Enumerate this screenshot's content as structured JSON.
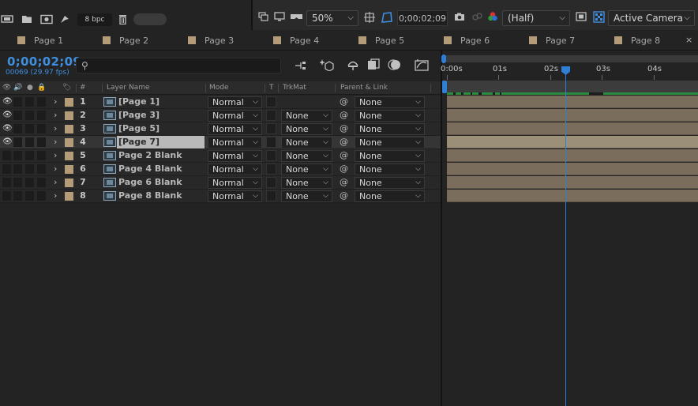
{
  "toolbar": {
    "bpc_label": "8 bpc",
    "zoom": "50%",
    "time": "0;00;02;09",
    "resolution": "(Half)",
    "camera": "Active Camera"
  },
  "tabs": [
    {
      "label": "Page 1"
    },
    {
      "label": "Page 2"
    },
    {
      "label": "Page 3"
    },
    {
      "label": "Page 4"
    },
    {
      "label": "Page 5"
    },
    {
      "label": "Page 6"
    },
    {
      "label": "Page 7"
    },
    {
      "label": "Page 8"
    }
  ],
  "tab_close": "×",
  "timecode": "0;00;02;09",
  "fps": "00069 (29.97 fps)",
  "search": {
    "placeholder": ""
  },
  "headers": {
    "num": "#",
    "layer_name": "Layer Name",
    "mode": "Mode",
    "t": "T",
    "trkmat": "TrkMat",
    "parent": "Parent & Link"
  },
  "layers": [
    {
      "num": "1",
      "name": "[Page 1]",
      "mode": "Normal",
      "trkmat": "",
      "parent": "None"
    },
    {
      "num": "2",
      "name": "[Page 3]",
      "mode": "Normal",
      "trkmat": "None",
      "parent": "None"
    },
    {
      "num": "3",
      "name": "[Page 5]",
      "mode": "Normal",
      "trkmat": "None",
      "parent": "None"
    },
    {
      "num": "4",
      "name": "[Page 7]",
      "mode": "Normal",
      "trkmat": "None",
      "parent": "None"
    },
    {
      "num": "5",
      "name": "Page 2 Blank",
      "mode": "Normal",
      "trkmat": "None",
      "parent": "None"
    },
    {
      "num": "6",
      "name": "Page 4 Blank",
      "mode": "Normal",
      "trkmat": "None",
      "parent": "None"
    },
    {
      "num": "7",
      "name": "Page 6 Blank",
      "mode": "Normal",
      "trkmat": "None",
      "parent": "None"
    },
    {
      "num": "8",
      "name": "Page 8 Blank",
      "mode": "Normal",
      "trkmat": "None",
      "parent": "None"
    }
  ],
  "ruler": [
    "0:00s",
    "01s",
    "02s",
    "03s",
    "04s"
  ],
  "colors": {
    "accent": "#2f7fd6",
    "label": "#b49c78",
    "clip": "#7a6d5b",
    "render": "#2b8c3f"
  }
}
